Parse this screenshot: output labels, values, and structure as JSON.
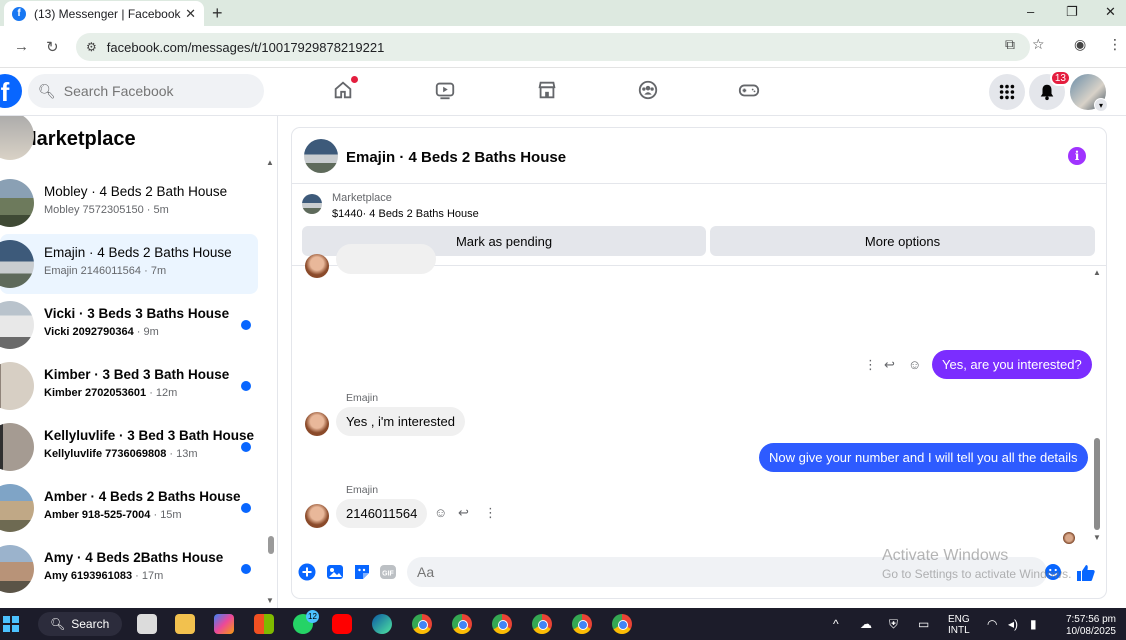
{
  "browser": {
    "tab_title": "(13) Messenger | Facebook",
    "tab_favicon": "f",
    "url": "facebook.com/messages/t/10017929878219221",
    "new_tab": "+",
    "minimize": "–",
    "restore": "❐",
    "close": "✕"
  },
  "fb": {
    "search_placeholder": "Search Facebook",
    "notification_count": "13",
    "brand_color": "#0866ff"
  },
  "left": {
    "title": "Marketplace",
    "conversations": [
      {
        "name": "Mobley · 4 Beds 2 Bath House",
        "sub": "Mobley 7572305150",
        "time": "5m",
        "unread": false,
        "active": false
      },
      {
        "name": "Emajin · 4 Beds 2 Baths House",
        "sub": "Emajin 2146011564",
        "time": "7m",
        "unread": false,
        "active": true
      },
      {
        "name": "Vicki · 3 Beds 3 Baths House",
        "sub": "Vicki 2092790364",
        "time": "9m",
        "unread": true,
        "active": false
      },
      {
        "name": "Kimber · 3 Bed 3 Bath House",
        "sub": "Kimber 2702053601",
        "time": "12m",
        "unread": true,
        "active": false
      },
      {
        "name": "Kellyluvlife · 3 Bed 3 Bath House",
        "sub": "Kellyluvlife 7736069808",
        "time": "13m",
        "unread": true,
        "active": false
      },
      {
        "name": "Amber · 4 Beds 2 Baths House",
        "sub": "Amber 918-525-7004",
        "time": "15m",
        "unread": true,
        "active": false
      },
      {
        "name": "Amy · 4 Beds 2Baths House",
        "sub": "Amy 6193961083",
        "time": "17m",
        "unread": true,
        "active": false
      }
    ]
  },
  "chat": {
    "title": "Emajin · 4 Beds 2 Baths House",
    "listing_label": "Marketplace",
    "listing_price": "$1440· 4 Beds 2 Baths House",
    "mark_pending": "Mark as pending",
    "more_options": "More options",
    "messages": {
      "out1": "Yes, are you interested?",
      "sender1": "Emajin",
      "in1": "Yes , i'm interested",
      "out2": "Now give your number and I will tell you all the details",
      "sender2": "Emajin",
      "in2": "2146011564"
    },
    "composer_placeholder": "Aa",
    "gif": "GIF"
  },
  "watermark": {
    "line1": "Activate Windows",
    "line2": "Go to Settings to activate Windows."
  },
  "taskbar": {
    "search": "Search",
    "whatsapp_badge": "12",
    "lang1": "ENG",
    "lang2": "INTL",
    "time": "7:57:56 pm",
    "date": "10/08/2025"
  }
}
